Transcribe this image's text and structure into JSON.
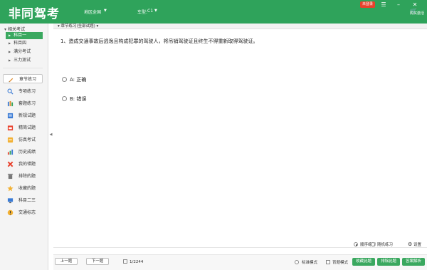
{
  "header": {
    "logo": "非同驾考",
    "region_label": "地区:",
    "region_value": "全国",
    "car_label": "车型:",
    "car_value": "C1",
    "badge": "未登录",
    "shop_label": "购买激活"
  },
  "sidebar": {
    "tree_title": "相关考试",
    "tree_items": [
      {
        "label": "科目一",
        "active": true
      },
      {
        "label": "科目四",
        "active": false
      },
      {
        "label": "满分考试",
        "active": false
      },
      {
        "label": "三力测试",
        "active": false
      }
    ],
    "nav_items": [
      {
        "label": "章节练习",
        "icon": "pencil-icon"
      },
      {
        "label": "专项练习",
        "icon": "magnifier-icon"
      },
      {
        "label": "套题练习",
        "icon": "stack-icon"
      },
      {
        "label": "新规试题",
        "icon": "document-icon"
      },
      {
        "label": "精简试题",
        "icon": "clipboard-icon"
      },
      {
        "label": "仿真考试",
        "icon": "hat-icon"
      },
      {
        "label": "历史成绩",
        "icon": "bar-chart-icon"
      },
      {
        "label": "我的错题",
        "icon": "cross-icon"
      },
      {
        "label": "排除的题",
        "icon": "trash-icon"
      },
      {
        "label": "收藏的题",
        "icon": "star-icon"
      },
      {
        "label": "科目二三",
        "icon": "monitor-icon"
      },
      {
        "label": "交通标志",
        "icon": "warning-icon"
      }
    ]
  },
  "content": {
    "breadcrumb": "章节练习(全部试题)",
    "question": "1、造成交通事故后逃逸且构成犯罪的驾驶人，将吊销驾驶证且终生不得重新取得驾驶证。",
    "options": [
      "A: 正确",
      "B: 错误"
    ],
    "mode_sequential": "顺序练习",
    "mode_random": "随机练习",
    "settings": "设置"
  },
  "footer": {
    "prev": "上一题",
    "next": "下一题",
    "counter": "1/2244",
    "standard_mode": "标准模式",
    "recite_mode": "背题模式",
    "btn_collect": "收藏此题",
    "btn_exclude": "排除此题",
    "btn_explain": "答案解析"
  },
  "colors": {
    "brand_green": "#2fa35b",
    "button_green": "#3aa85f",
    "badge_red": "#e8412c"
  }
}
